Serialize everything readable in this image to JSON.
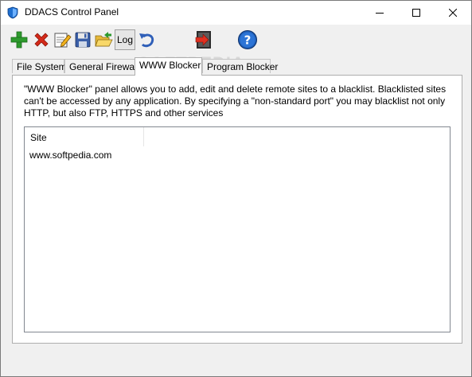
{
  "window": {
    "title": "DDACS Control Panel"
  },
  "toolbar": {
    "buttons": [
      {
        "name": "add-icon"
      },
      {
        "name": "delete-icon"
      },
      {
        "name": "edit-icon"
      },
      {
        "name": "save-icon"
      },
      {
        "name": "open-folder-icon"
      },
      {
        "name": "log-button",
        "label": "Log"
      },
      {
        "name": "undo-icon"
      },
      {
        "name": "exit-icon"
      },
      {
        "name": "help-icon"
      }
    ],
    "log_label": "Log",
    "watermark": "SOFTPEDIA"
  },
  "tabs": [
    {
      "label": "File System",
      "active": false
    },
    {
      "label": "General Firewall",
      "active": false
    },
    {
      "label": "WWW Blocker",
      "active": true
    },
    {
      "label": "Program Blocker",
      "active": false
    }
  ],
  "panel": {
    "description": "\"WWW Blocker\" panel allows you to add, edit and delete remote sites to a blacklist. Blacklisted sites can't be accessed by any application. By specifying a \"non-standard port\" you may blacklist not only HTTP, but also FTP, HTTPS and other services",
    "list": {
      "column_header": "Site",
      "rows": [
        "www.softpedia.com"
      ]
    }
  },
  "colors": {
    "accent": "#0a64c8",
    "add": "#2e9a2e",
    "delete": "#d42a1a",
    "help": "#1f5fb8"
  }
}
